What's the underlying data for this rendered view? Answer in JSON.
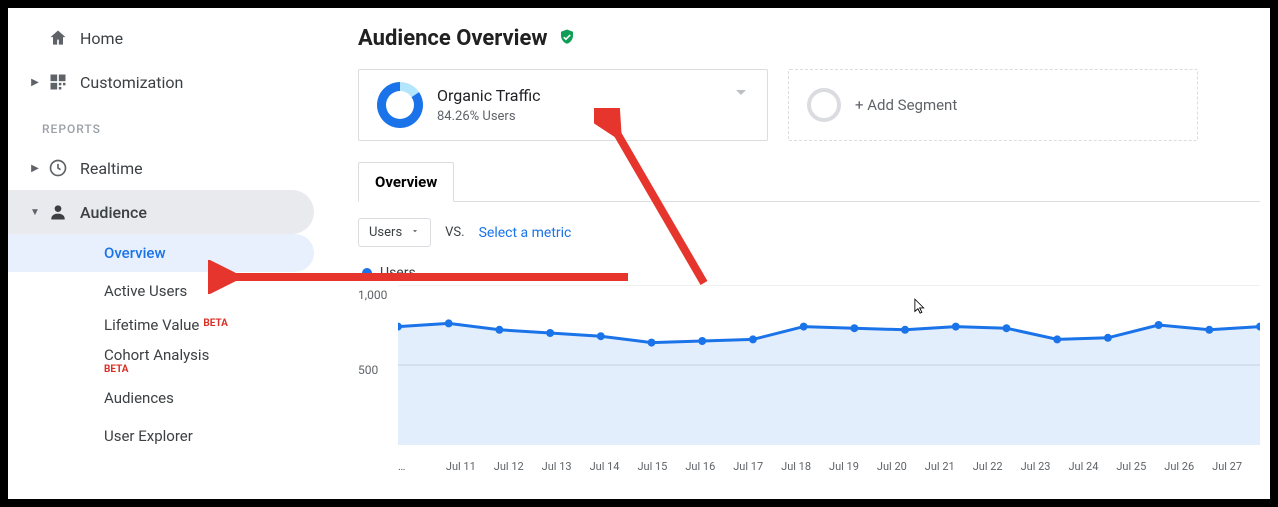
{
  "sidebar": {
    "home": "Home",
    "customization": "Customization",
    "section_reports": "REPORTS",
    "realtime": "Realtime",
    "audience": "Audience",
    "subs": {
      "overview": "Overview",
      "active_users": "Active Users",
      "lifetime_value": "Lifetime Value",
      "cohort": "Cohort Analysis",
      "audiences": "Audiences",
      "user_explorer": "User Explorer"
    },
    "beta": "BETA"
  },
  "header": {
    "title": "Audience Overview"
  },
  "segments": {
    "organic_title": "Organic Traffic",
    "organic_sub": "84.26% Users",
    "add": "+ Add Segment"
  },
  "tabs": {
    "overview": "Overview"
  },
  "controls": {
    "metric": "Users",
    "vs": "VS.",
    "select": "Select a metric"
  },
  "legend": {
    "users": "Users"
  },
  "chart_data": {
    "type": "line",
    "title": "",
    "xlabel": "",
    "ylabel": "",
    "ylim": [
      0,
      1000
    ],
    "yticks": [
      500,
      1000
    ],
    "categories": [
      "…",
      "Jul 11",
      "Jul 12",
      "Jul 13",
      "Jul 14",
      "Jul 15",
      "Jul 16",
      "Jul 17",
      "Jul 18",
      "Jul 19",
      "Jul 20",
      "Jul 21",
      "Jul 22",
      "Jul 23",
      "Jul 24",
      "Jul 25",
      "Jul 26",
      "Jul 27"
    ],
    "series": [
      {
        "name": "Users",
        "color": "#1a73e8",
        "values": [
          740,
          760,
          720,
          700,
          680,
          640,
          650,
          660,
          740,
          730,
          720,
          740,
          730,
          660,
          670,
          750,
          720,
          740
        ]
      }
    ]
  }
}
